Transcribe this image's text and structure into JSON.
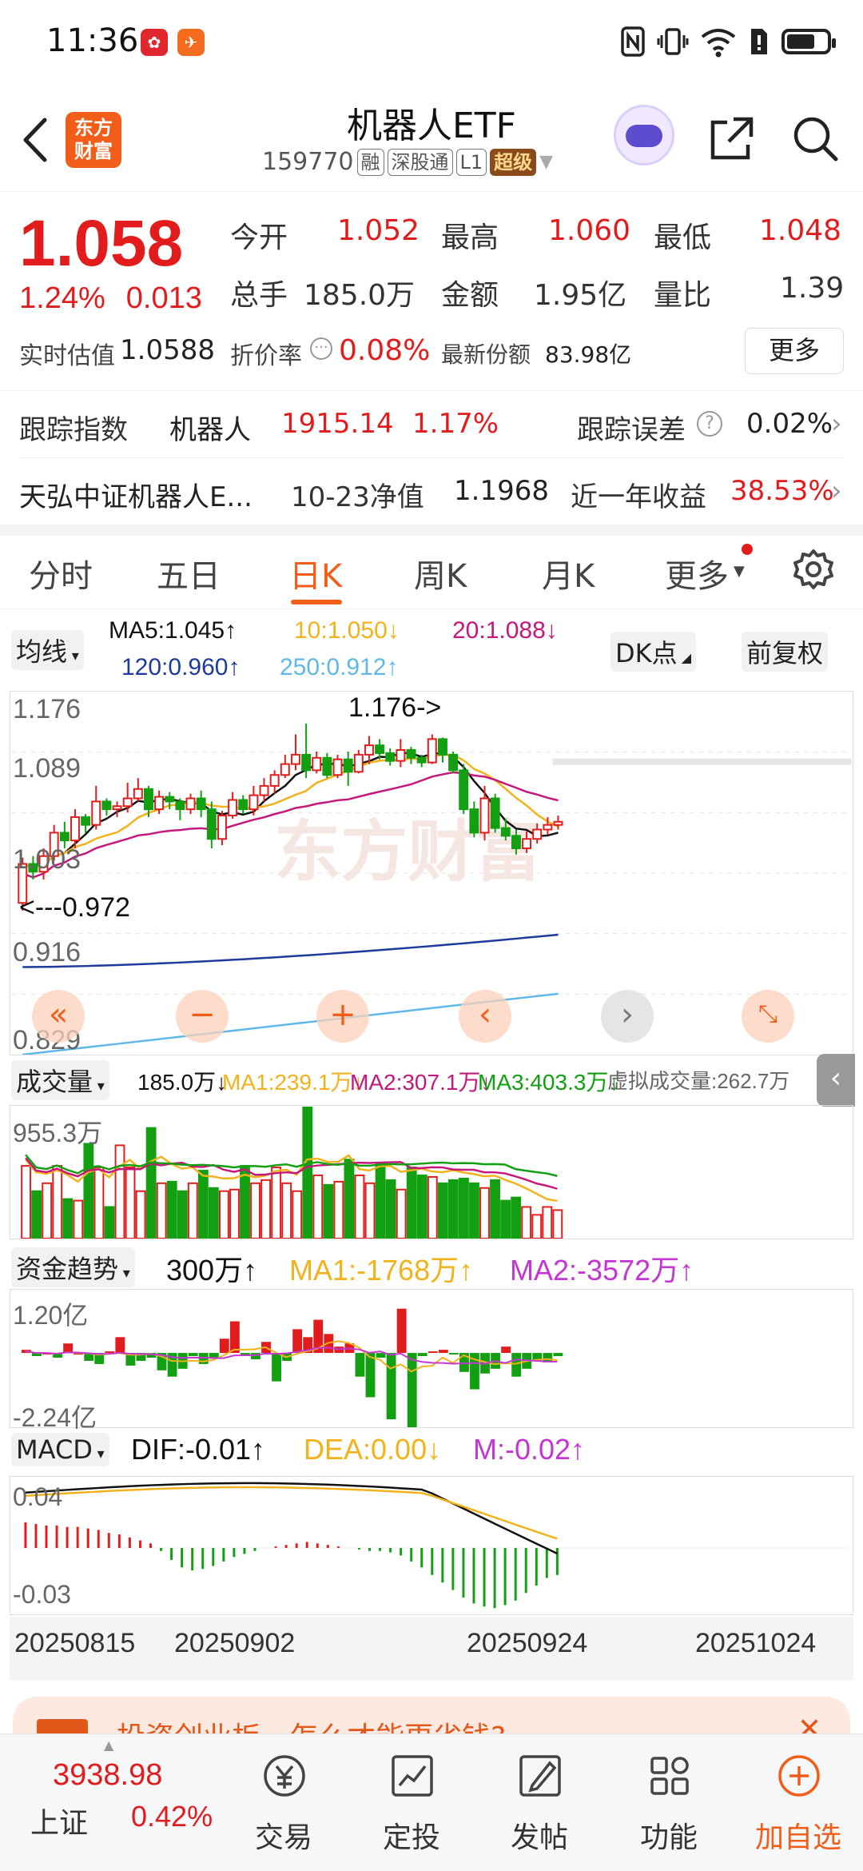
{
  "status_bar": {
    "time": "11:36"
  },
  "header": {
    "title": "机器人ETF",
    "code": "159770",
    "tags": [
      "融",
      "深股通",
      "L1",
      "超级"
    ]
  },
  "quote": {
    "price": "1.058",
    "change_pct": "1.24%",
    "change": "0.013",
    "open_label": "今开",
    "open": "1.052",
    "high_label": "最高",
    "high": "1.060",
    "low_label": "最低",
    "low": "1.048",
    "volume_label": "总手",
    "volume": "185.0万",
    "amount_label": "金额",
    "amount": "1.95亿",
    "ratio_label": "量比",
    "ratio": "1.39",
    "est_label": "实时估值",
    "est": "1.0588",
    "discount_label": "折价率",
    "discount": "0.08%",
    "shares_label": "最新份额",
    "shares": "83.98亿",
    "more": "更多"
  },
  "tracking": {
    "index_label": "跟踪指数",
    "index_name": "机器人",
    "index_value": "1915.14",
    "index_pct": "1.17%",
    "error_label": "跟踪误差",
    "error_value": "0.02%",
    "fund_name": "天弘中证机器人E...",
    "nav_date": "10-23净值",
    "nav": "1.1968",
    "return_label": "近一年收益",
    "return_value": "38.53%"
  },
  "tabs": [
    "分时",
    "五日",
    "日K",
    "周K",
    "月K",
    "更多"
  ],
  "kline": {
    "ma_selector": "均线",
    "ma5": "MA5:1.045↑",
    "ma10": "10:1.050↓",
    "ma20": "20:1.088↓",
    "ma120": "120:0.960↑",
    "ma250": "250:0.912↑",
    "dk_button": "DK点",
    "adjust_button": "前复权",
    "y_labels": [
      "1.176",
      "1.089",
      "1.003",
      "0.916",
      "0.829"
    ],
    "max_marker": "1.176->",
    "min_marker": "<---0.972",
    "watermark": "东方财富",
    "colors": {
      "up": "#e21c1c",
      "down": "#12a012",
      "ma5": "#111111",
      "ma10": "#f2b21b",
      "ma20": "#c4187c",
      "ma120": "#1d3a9c",
      "ma250": "#5fb8e8"
    }
  },
  "volume": {
    "selector": "成交量",
    "current": "185.0万↓",
    "ma1": "MA1:239.1万↓",
    "ma2": "MA2:307.1万↓",
    "ma3": "MA3:403.3万↓",
    "virtual": "虚拟成交量:262.7万",
    "y_top": "955.3万"
  },
  "fund_flow": {
    "selector": "资金趋势",
    "current": "300万↑",
    "ma1": "MA1:-1768万↑",
    "ma2": "MA2:-3572万↑",
    "y_top": "1.20亿",
    "y_bottom": "-2.24亿"
  },
  "macd": {
    "selector": "MACD",
    "dif": "DIF:-0.01↑",
    "dea": "DEA:0.00↓",
    "m": "M:-0.02↑",
    "y_top": "0.04",
    "y_bottom": "-0.03"
  },
  "dates": [
    "20250815",
    "20250902",
    "20250924",
    "20251024"
  ],
  "promo": {
    "text": "投资创业板，怎么才能更省钱?"
  },
  "bottom_index": {
    "value": "3938.98",
    "name": "上证",
    "pct": "0.42%"
  },
  "bottom_nav": [
    "交易",
    "定投",
    "发帖",
    "功能",
    "加自选"
  ]
}
